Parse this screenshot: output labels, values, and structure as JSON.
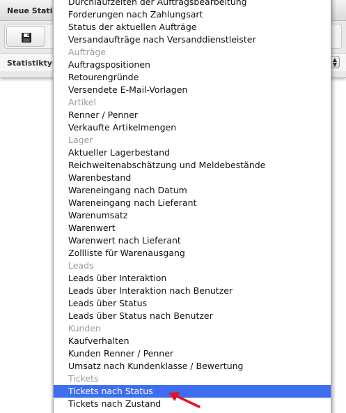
{
  "dialog": {
    "title": "Neue Statis",
    "type_label": "Statistiktyp",
    "save_icon": "save-icon",
    "stepper_icon": "select-stepper-icon"
  },
  "dropdown": {
    "options": [
      {
        "label": "Durchlaufzeiten der Auftragsbearbeitung",
        "kind": "item"
      },
      {
        "label": "Forderungen nach Zahlungsart",
        "kind": "item"
      },
      {
        "label": "Status der aktuellen Aufträge",
        "kind": "item"
      },
      {
        "label": "Versandaufträge nach Versanddienstleister",
        "kind": "item"
      },
      {
        "label": "Aufträge",
        "kind": "group"
      },
      {
        "label": "Auftragspositionen",
        "kind": "item"
      },
      {
        "label": "Retourengründe",
        "kind": "item"
      },
      {
        "label": "Versendete E-Mail-Vorlagen",
        "kind": "item"
      },
      {
        "label": "Artikel",
        "kind": "group"
      },
      {
        "label": "Renner / Penner",
        "kind": "item"
      },
      {
        "label": "Verkaufte Artikelmengen",
        "kind": "item"
      },
      {
        "label": "Lager",
        "kind": "group"
      },
      {
        "label": "Aktueller Lagerbestand",
        "kind": "item"
      },
      {
        "label": "Reichweitenabschätzung und Meldebestände",
        "kind": "item"
      },
      {
        "label": "Warenbestand",
        "kind": "item"
      },
      {
        "label": "Wareneingang nach Datum",
        "kind": "item"
      },
      {
        "label": "Wareneingang nach Lieferant",
        "kind": "item"
      },
      {
        "label": "Warenumsatz",
        "kind": "item"
      },
      {
        "label": "Warenwert",
        "kind": "item"
      },
      {
        "label": "Warenwert nach Lieferant",
        "kind": "item"
      },
      {
        "label": "Zollliste für Warenausgang",
        "kind": "item"
      },
      {
        "label": "Leads",
        "kind": "group"
      },
      {
        "label": "Leads über Interaktion",
        "kind": "item"
      },
      {
        "label": "Leads über Interaktion nach Benutzer",
        "kind": "item"
      },
      {
        "label": "Leads über Status",
        "kind": "item"
      },
      {
        "label": "Leads über Status nach Benutzer",
        "kind": "item"
      },
      {
        "label": "Kunden",
        "kind": "group"
      },
      {
        "label": "Kaufverhalten",
        "kind": "item"
      },
      {
        "label": "Kunden Renner / Penner",
        "kind": "item"
      },
      {
        "label": "Umsatz nach Kundenklasse / Bewertung",
        "kind": "item"
      },
      {
        "label": "Tickets",
        "kind": "group"
      },
      {
        "label": "Tickets nach Status",
        "kind": "item",
        "selected": true
      },
      {
        "label": "Tickets nach Zustand",
        "kind": "item"
      }
    ]
  },
  "annotation": {
    "icon": "red-arrow-icon",
    "color": "#e8101c"
  },
  "colors": {
    "selection": "#3e6ef0",
    "group_label": "#9a9a9a"
  }
}
